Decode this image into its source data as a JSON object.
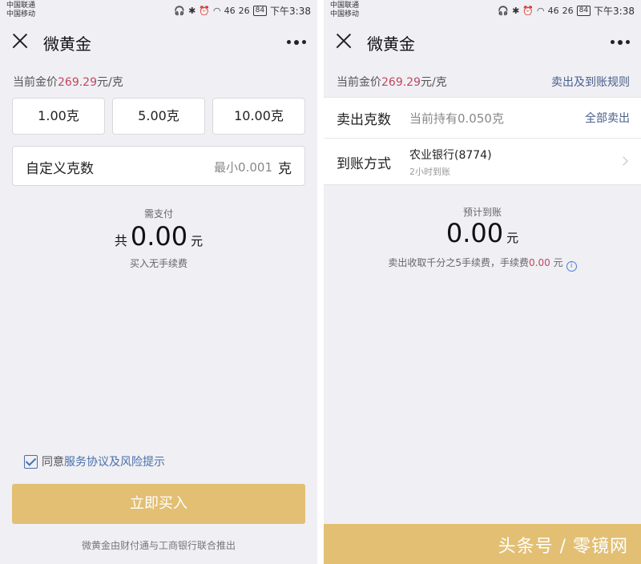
{
  "status": {
    "carrier1": "中国联通",
    "carrier2": "中国移动",
    "signal1": "46",
    "signal2": "26",
    "battery": "84",
    "time": "下午3:38"
  },
  "buy": {
    "title": "微黄金",
    "price_prefix": "当前金价",
    "price_value": "269.29",
    "price_unit": "元/克",
    "quick_amounts": [
      "1.00克",
      "5.00克",
      "10.00克"
    ],
    "custom_label": "自定义克数",
    "custom_placeholder": "最小0.001",
    "custom_unit": "克",
    "pay_label": "需支付",
    "total_prefix": "共",
    "total_amount": "0.00",
    "currency": "元",
    "fee_note": "买入无手续费",
    "agree_prefix": "同意",
    "agree_link": "服务协议及风险提示",
    "buy_button": "立即买入",
    "footer": "微黄金由财付通与工商银行联合推出"
  },
  "sell": {
    "title": "微黄金",
    "price_prefix": "当前金价",
    "price_value": "269.29",
    "price_unit": "元/克",
    "rules_link": "卖出及到账规则",
    "amount_label": "卖出克数",
    "amount_placeholder": "当前持有0.050克",
    "sell_all": "全部卖出",
    "method_label": "到账方式",
    "bank_name": "农业银行(8774)",
    "bank_eta": "2小时到账",
    "expected_label": "预计到账",
    "expected_amount": "0.00",
    "currency": "元",
    "fee_note_prefix": "卖出收取千分之5手续费，手续费",
    "fee_value": "0.00",
    "fee_unit": "元",
    "watermark": "头条号 / 零镜网"
  },
  "colors": {
    "accent_gold": "#e2bf73",
    "price_red": "#c2475e",
    "link_blue": "#4a5f8a"
  }
}
